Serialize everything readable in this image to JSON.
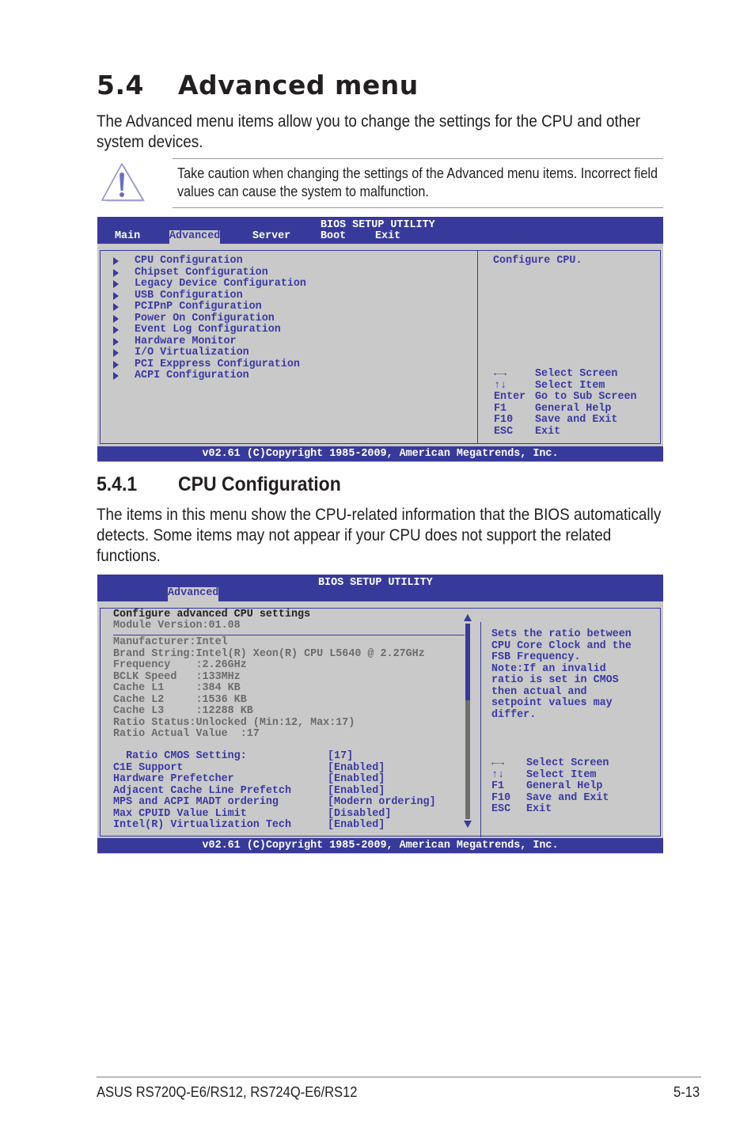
{
  "section": {
    "number": "5.4",
    "title": "Advanced menu",
    "intro": "The Advanced menu items allow you to change the settings for the CPU and other system devices."
  },
  "caution": {
    "icon": "warning-triangle-icon",
    "text": "Take caution when changing the settings of the Advanced menu items. Incorrect field values can cause the system to malfunction."
  },
  "bios1": {
    "title": "BIOS SETUP UTILITY",
    "tabs": [
      "Main",
      "Advanced",
      "Server",
      "Boot",
      "Exit"
    ],
    "items": [
      "CPU Configuration",
      "Chipset Configuration",
      "Legacy Device Configuration",
      "USB Configuration",
      "PCIPnP Configuration",
      "Power On Configuration",
      "Event Log Configuration",
      "Hardware Monitor",
      "I/O Virtualization",
      "PCI Exppress Configuration",
      "ACPI Configuration"
    ],
    "help": "Configure CPU.",
    "keys": [
      {
        "k": "←→",
        "d": "Select Screen"
      },
      {
        "k": "↑↓",
        "d": "Select Item"
      },
      {
        "k": "Enter",
        "d": "Go to Sub Screen"
      },
      {
        "k": "F1",
        "d": "General Help"
      },
      {
        "k": "F10",
        "d": "Save and Exit"
      },
      {
        "k": "ESC",
        "d": "Exit"
      }
    ],
    "footer": "v02.61 (C)Copyright 1985-2009, American Megatrends, Inc."
  },
  "subsection": {
    "number": "5.4.1",
    "title": "CPU Configuration",
    "intro": "The items in this menu show the CPU-related information that the BIOS automatically detects. Some items may not appear if your CPU does not support the related functions."
  },
  "bios2": {
    "title": "BIOS SETUP UTILITY",
    "tab": "Advanced",
    "heading": "Configure advanced CPU settings",
    "module": "Module Version:01.08",
    "info": [
      "Manufacturer:Intel",
      "Brand String:Intel(R) Xeon(R) CPU L5640 @ 2.27GHz",
      "Frequency    :2.26GHz",
      "BCLK Speed   :133MHz",
      "Cache L1     :384 KB",
      "Cache L2     :1536 KB",
      "Cache L3     :12288 KB",
      "Ratio Status:Unlocked (Min:12, Max:17)",
      "Ratio Actual Value  :17"
    ],
    "settings": [
      {
        "name": "  Ratio CMOS Setting:",
        "value": "[17]"
      },
      {
        "name": "C1E Support",
        "value": "[Enabled]"
      },
      {
        "name": "Hardware Prefetcher",
        "value": "[Enabled]"
      },
      {
        "name": "Adjacent Cache Line Prefetch",
        "value": "[Enabled]"
      },
      {
        "name": "MPS and ACPI MADT ordering",
        "value": "[Modern ordering]"
      },
      {
        "name": "Max CPUID Value Limit",
        "value": "[Disabled]"
      },
      {
        "name": "Intel(R) Virtualization Tech",
        "value": "[Enabled]"
      }
    ],
    "help": "Sets the ratio between\nCPU Core Clock and the\nFSB Frequency.\nNote:If an invalid\nratio is set in CMOS\nthen actual and\nsetpoint values may\ndiffer.",
    "keys": [
      {
        "k": "←→",
        "d": "Select Screen"
      },
      {
        "k": "↑↓",
        "d": "Select Item"
      },
      {
        "k": "F1",
        "d": "General Help"
      },
      {
        "k": "F10",
        "d": "Save and Exit"
      },
      {
        "k": "ESC",
        "d": "Exit"
      }
    ],
    "footer": "v02.61 (C)Copyright 1985-2009, American Megatrends, Inc."
  },
  "page_footer": {
    "model": "ASUS RS720Q-E6/RS12, RS724Q-E6/RS12",
    "page": "5-13"
  }
}
